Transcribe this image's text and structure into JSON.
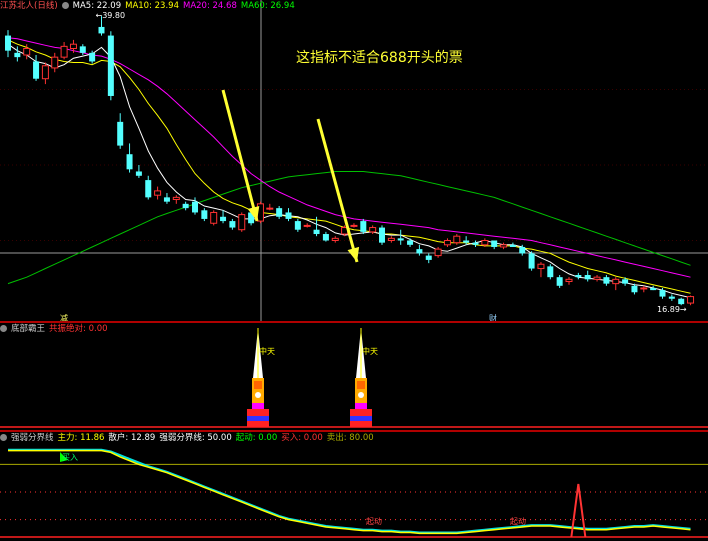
{
  "main_panel": {
    "title": "江苏北人(日线)",
    "indicators": [
      {
        "label": "MA5: 22.09",
        "color": "#ffffff"
      },
      {
        "label": "MA10: 23.94",
        "color": "#ffff00"
      },
      {
        "label": "MA20: 24.68",
        "color": "#ff00ff"
      },
      {
        "label": "MA60: 26.94",
        "color": "#00ff00"
      }
    ],
    "high_price": "39.80",
    "low_price": "16.89",
    "note": "这指标不适合688开头的票",
    "markers": [
      "减",
      "财"
    ]
  },
  "panel2": {
    "title": "底部霸王",
    "indicator": "共振绝对: 0.00",
    "labels": [
      "中天",
      "中天"
    ]
  },
  "panel3": {
    "title": "强弱分界线",
    "indicators": [
      {
        "label": "主力: 11.86",
        "color": "#ffff00"
      },
      {
        "label": "散户: 12.89",
        "color": "#ffffff"
      },
      {
        "label": "强弱分界线: 50.00",
        "color": "#ffffff"
      },
      {
        "label": "起动: 0.00",
        "color": "#00ff00"
      },
      {
        "label": "买入: 0.00",
        "color": "#ff3333"
      },
      {
        "label": "卖出: 80.00",
        "color": "#aaaa00"
      }
    ],
    "annotations": [
      "起动",
      "起动",
      "买入"
    ]
  },
  "colors": {
    "up": "#ff3232",
    "down": "#54ffff",
    "ma5": "#ffffff",
    "ma10": "#ffff00",
    "ma20": "#ff00ff",
    "ma60": "#00c000",
    "cursor": "#9a9a9a",
    "separator": "#b00000",
    "arrow": "#ffff33"
  },
  "chart_data": {
    "type": "candlestick",
    "candles": [
      [
        38.0,
        38.5,
        36.0,
        36.6
      ],
      [
        36.4,
        37.0,
        35.6,
        36.0
      ],
      [
        36.2,
        37.2,
        35.8,
        36.8
      ],
      [
        35.6,
        36.2,
        33.8,
        34.0
      ],
      [
        34.0,
        35.5,
        33.5,
        35.2
      ],
      [
        35.0,
        36.4,
        34.6,
        36.0
      ],
      [
        36.0,
        37.4,
        35.8,
        37.0
      ],
      [
        36.8,
        37.6,
        36.4,
        37.2
      ],
      [
        37.0,
        37.2,
        36.2,
        36.4
      ],
      [
        36.4,
        36.6,
        35.4,
        35.6
      ],
      [
        38.8,
        39.8,
        38.0,
        38.2
      ],
      [
        38.0,
        38.4,
        32.0,
        32.4
      ],
      [
        30.0,
        30.8,
        27.5,
        27.8
      ],
      [
        27.0,
        28.0,
        25.3,
        25.6
      ],
      [
        25.4,
        26.0,
        24.8,
        25.0
      ],
      [
        24.6,
        25.0,
        22.8,
        23.0
      ],
      [
        23.2,
        24.0,
        22.8,
        23.6
      ],
      [
        23.0,
        23.4,
        22.4,
        22.6
      ],
      [
        22.8,
        23.2,
        22.4,
        23.0
      ],
      [
        22.4,
        22.6,
        21.8,
        22.0
      ],
      [
        22.6,
        23.0,
        21.4,
        21.6
      ],
      [
        21.8,
        22.0,
        20.8,
        21.0
      ],
      [
        20.6,
        21.8,
        20.4,
        21.6
      ],
      [
        21.2,
        21.8,
        20.6,
        20.8
      ],
      [
        20.8,
        21.0,
        20.0,
        20.2
      ],
      [
        20.0,
        21.6,
        19.8,
        21.4
      ],
      [
        21.6,
        21.8,
        20.4,
        20.6
      ],
      [
        20.8,
        22.6,
        20.6,
        22.4
      ],
      [
        22.0,
        22.4,
        21.8,
        22.0
      ],
      [
        22.0,
        22.2,
        21.0,
        21.2
      ],
      [
        21.6,
        22.0,
        20.8,
        21.0
      ],
      [
        20.8,
        21.0,
        19.8,
        20.0
      ],
      [
        20.4,
        20.6,
        20.2,
        20.4
      ],
      [
        20.0,
        21.2,
        19.4,
        19.6
      ],
      [
        19.6,
        19.8,
        18.9,
        19.0
      ],
      [
        19.0,
        19.4,
        18.8,
        19.2
      ],
      [
        19.6,
        20.4,
        19.4,
        20.2
      ],
      [
        20.4,
        20.6,
        20.2,
        20.4
      ],
      [
        20.8,
        21.0,
        19.6,
        19.8
      ],
      [
        19.8,
        20.4,
        19.6,
        20.2
      ],
      [
        20.2,
        20.4,
        18.6,
        18.8
      ],
      [
        19.0,
        19.4,
        18.8,
        19.2
      ],
      [
        19.2,
        20.0,
        18.6,
        19.0
      ],
      [
        19.0,
        19.2,
        18.4,
        18.6
      ],
      [
        18.2,
        18.6,
        17.6,
        17.8
      ],
      [
        17.6,
        17.8,
        16.9,
        17.2
      ],
      [
        17.6,
        18.4,
        17.4,
        18.2
      ],
      [
        18.6,
        19.2,
        18.4,
        19.0
      ],
      [
        18.8,
        19.6,
        18.6,
        19.4
      ],
      [
        19.0,
        19.4,
        18.6,
        18.8
      ],
      [
        18.8,
        19.0,
        18.4,
        18.6
      ],
      [
        18.6,
        19.2,
        18.4,
        19.0
      ],
      [
        19.0,
        19.0,
        18.2,
        18.4
      ],
      [
        18.4,
        18.8,
        18.2,
        18.6
      ],
      [
        18.6,
        18.8,
        18.4,
        18.4
      ],
      [
        18.4,
        18.6,
        17.6,
        17.8
      ],
      [
        17.8,
        18.0,
        16.2,
        16.4
      ],
      [
        16.4,
        17.0,
        15.6,
        16.8
      ],
      [
        16.6,
        16.8,
        15.4,
        15.6
      ],
      [
        15.6,
        15.8,
        14.6,
        14.8
      ],
      [
        15.2,
        15.6,
        14.9,
        15.4
      ],
      [
        15.8,
        16.0,
        15.4,
        15.6
      ],
      [
        15.8,
        16.2,
        15.2,
        15.4
      ],
      [
        15.4,
        15.8,
        15.2,
        15.6
      ],
      [
        15.6,
        15.8,
        14.8,
        15.0
      ],
      [
        15.0,
        15.6,
        14.4,
        15.4
      ],
      [
        15.4,
        15.6,
        14.8,
        15.0
      ],
      [
        14.8,
        15.0,
        14.0,
        14.2
      ],
      [
        14.6,
        14.8,
        14.2,
        14.6
      ],
      [
        14.6,
        14.8,
        14.4,
        14.4
      ],
      [
        14.4,
        14.6,
        13.6,
        13.8
      ],
      [
        13.8,
        14.0,
        13.4,
        13.6
      ],
      [
        13.6,
        13.7,
        13.0,
        13.1
      ],
      [
        13.2,
        13.9,
        13.0,
        13.8
      ]
    ],
    "ma5": [
      37.2,
      36.6,
      36.2,
      35.6,
      35.4,
      35.0,
      35.3,
      35.9,
      36.1,
      36.3,
      36.9,
      36.0,
      34.2,
      31.4,
      29.4,
      27.3,
      25.7,
      24.4,
      23.5,
      22.8,
      22.7,
      22.2,
      22.0,
      21.8,
      21.4,
      21.0,
      21.0,
      21.0,
      21.3,
      21.4,
      21.3,
      21.2,
      20.9,
      20.5,
      20.2,
      19.7,
      19.5,
      19.6,
      19.7,
      19.8,
      19.6,
      19.5,
      19.5,
      19.1,
      18.7,
      18.5,
      18.1,
      18.0,
      18.3,
      18.6,
      18.8,
      19.0,
      18.8,
      18.6,
      18.6,
      18.4,
      17.8,
      17.4,
      17.0,
      16.4,
      15.9,
      15.6,
      15.5,
      15.4,
      15.3,
      15.2,
      15.1,
      14.9,
      14.8,
      14.6,
      14.4,
      14.1,
      13.9,
      13.7
    ],
    "ma10": [
      37.6,
      37.2,
      36.9,
      36.5,
      36.2,
      35.8,
      35.6,
      35.5,
      35.5,
      35.3,
      35.7,
      35.6,
      35.1,
      34.1,
      33.0,
      31.7,
      30.6,
      29.4,
      27.9,
      26.5,
      25.2,
      24.3,
      23.5,
      22.9,
      22.5,
      22.2,
      21.8,
      21.6,
      21.5,
      21.4,
      21.2,
      21.1,
      21.0,
      20.9,
      20.8,
      20.5,
      20.2,
      20.0,
      19.9,
      19.8,
      19.6,
      19.6,
      19.5,
      19.4,
      19.3,
      19.1,
      18.9,
      18.8,
      18.8,
      18.8,
      18.6,
      18.5,
      18.5,
      18.5,
      18.5,
      18.3,
      18.2,
      18.0,
      17.8,
      17.4,
      17.0,
      16.7,
      16.4,
      16.2,
      16.0,
      15.7,
      15.5,
      15.3,
      15.1,
      14.9,
      14.7,
      14.5,
      14.3,
      14.1
    ],
    "ma20": [
      37.8,
      37.7,
      37.5,
      37.3,
      37.1,
      36.9,
      36.8,
      36.6,
      36.4,
      36.2,
      36.1,
      35.8,
      35.4,
      34.9,
      34.4,
      33.9,
      33.3,
      32.6,
      31.8,
      31.0,
      30.2,
      29.4,
      28.6,
      27.7,
      26.8,
      26.0,
      25.2,
      24.6,
      24.0,
      23.5,
      23.1,
      22.7,
      22.3,
      22.0,
      21.7,
      21.4,
      21.2,
      21.0,
      20.9,
      20.8,
      20.7,
      20.6,
      20.5,
      20.4,
      20.3,
      20.2,
      20.0,
      19.9,
      19.8,
      19.7,
      19.6,
      19.5,
      19.4,
      19.3,
      19.2,
      19.1,
      19.0,
      18.8,
      18.6,
      18.4,
      18.2,
      18.0,
      17.8,
      17.6,
      17.4,
      17.2,
      17.0,
      16.8,
      16.6,
      16.4,
      16.2,
      16.0,
      15.8,
      15.6
    ],
    "ma60": [
      15.0,
      15.3,
      15.6,
      16.0,
      16.4,
      16.8,
      17.2,
      17.6,
      18.0,
      18.4,
      18.8,
      19.2,
      19.6,
      20.0,
      20.4,
      20.8,
      21.2,
      21.5,
      21.8,
      22.1,
      22.4,
      22.7,
      23.0,
      23.3,
      23.6,
      23.9,
      24.1,
      24.3,
      24.5,
      24.7,
      24.9,
      25.0,
      25.1,
      25.2,
      25.3,
      25.4,
      25.4,
      25.4,
      25.4,
      25.3,
      25.2,
      25.1,
      25.0,
      24.8,
      24.6,
      24.4,
      24.2,
      24.0,
      23.8,
      23.6,
      23.4,
      23.2,
      23.0,
      22.7,
      22.4,
      22.1,
      21.8,
      21.5,
      21.2,
      20.9,
      20.6,
      20.3,
      20.0,
      19.7,
      19.4,
      19.1,
      18.8,
      18.5,
      18.2,
      17.9,
      17.6,
      17.3,
      17.0,
      16.7
    ],
    "zhuli": [
      95,
      95,
      95,
      95,
      95,
      95,
      95,
      95,
      95,
      95,
      95,
      93,
      88,
      84,
      80,
      77,
      74,
      71,
      67,
      63,
      59,
      55,
      51,
      47,
      43,
      39,
      35,
      31,
      27,
      23,
      20,
      18,
      16,
      14,
      12,
      11,
      10,
      9,
      8,
      8,
      7,
      7,
      6,
      6,
      5,
      5,
      5,
      5,
      5,
      6,
      7,
      8,
      9,
      10,
      11,
      12,
      13,
      13,
      13,
      12,
      11,
      10,
      9,
      9,
      9,
      10,
      11,
      12,
      12,
      13,
      12,
      11,
      10,
      9
    ],
    "sanhu": [
      96,
      96,
      96,
      96,
      96,
      96,
      96,
      96,
      96,
      96,
      96,
      94,
      90,
      86,
      82,
      78,
      75,
      72,
      68,
      64,
      60,
      56,
      52,
      48,
      44,
      40,
      36,
      32,
      28,
      24,
      21,
      19,
      17,
      15,
      13,
      12,
      11,
      10,
      9,
      9,
      8,
      8,
      7,
      7,
      6,
      6,
      6,
      6,
      6,
      7,
      8,
      9,
      10,
      11,
      12,
      13,
      14,
      14,
      14,
      13,
      12,
      11,
      10,
      10,
      10,
      11,
      12,
      13,
      13,
      14,
      13,
      12,
      11,
      10
    ],
    "spike_index": 61
  }
}
